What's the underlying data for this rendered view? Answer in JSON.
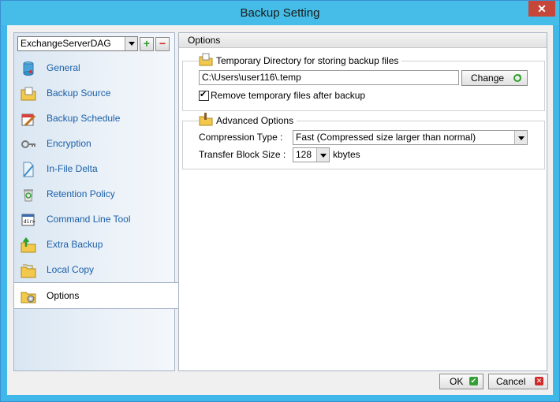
{
  "window": {
    "title": "Backup Setting",
    "close_glyph": "✕"
  },
  "backup_set": {
    "selected": "ExchangeServerDAG",
    "add_glyph": "+",
    "remove_glyph": "−"
  },
  "nav": {
    "items": [
      {
        "label": "General",
        "icon": "database-icon"
      },
      {
        "label": "Backup Source",
        "icon": "folder-icon"
      },
      {
        "label": "Backup Schedule",
        "icon": "schedule-icon"
      },
      {
        "label": "Encryption",
        "icon": "key-icon"
      },
      {
        "label": "In-File Delta",
        "icon": "document-icon"
      },
      {
        "label": "Retention Policy",
        "icon": "recycle-bin-icon"
      },
      {
        "label": "Command Line Tool",
        "icon": "command-prompt-icon"
      },
      {
        "label": "Extra Backup",
        "icon": "folder-arrow-icon"
      },
      {
        "label": "Local Copy",
        "icon": "folder-copy-icon"
      },
      {
        "label": "Options",
        "icon": "gear-folder-icon",
        "selected": true
      }
    ]
  },
  "options": {
    "header": "Options",
    "temp_dir": {
      "title": "Temporary Directory for storing backup files",
      "path": "C:\\Users\\user116\\.temp",
      "change_label": "Change",
      "remove_temp_label": "Remove temporary files after backup",
      "remove_temp_checked": true
    },
    "advanced": {
      "title": "Advanced Options",
      "compression_label": "Compression Type :",
      "compression_value": "Fast (Compressed size larger than normal)",
      "block_size_label": "Transfer Block Size :",
      "block_size_value": "128",
      "block_size_unit": "kbytes"
    }
  },
  "buttons": {
    "ok": "OK",
    "cancel": "Cancel"
  },
  "colors": {
    "title_bar": "#45bde8",
    "close": "#c7463a",
    "link": "#1a5fa8"
  }
}
